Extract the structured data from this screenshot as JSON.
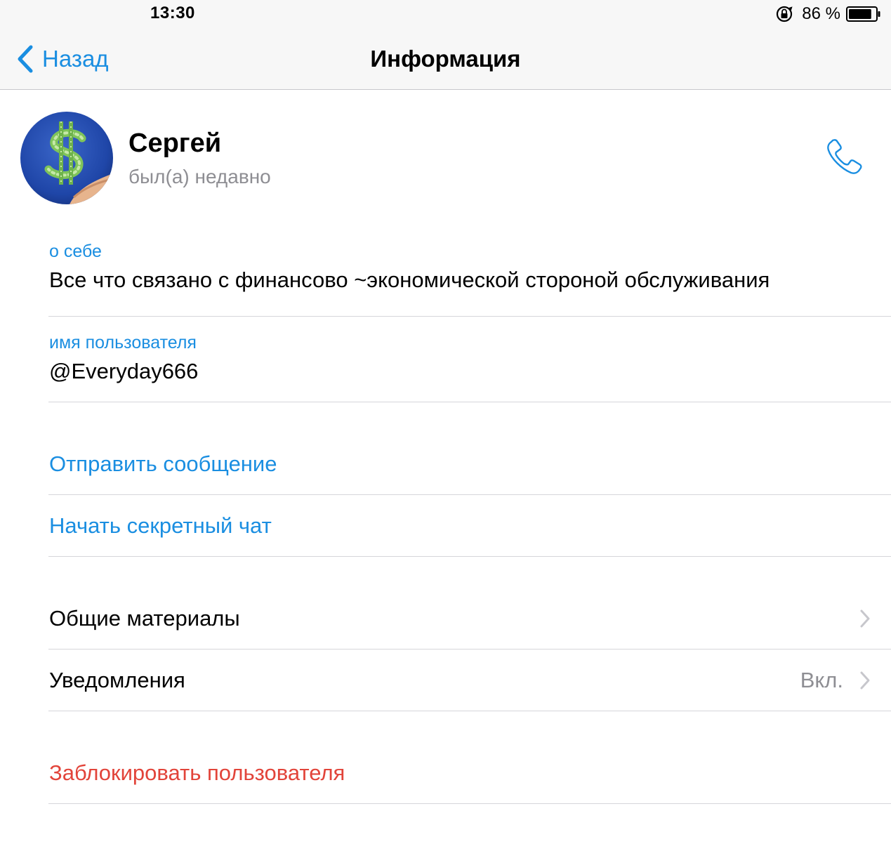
{
  "status_bar": {
    "time": "13:30",
    "battery_percent": "86 %",
    "battery_level": 0.86,
    "icons": [
      "orientation-lock-icon",
      "battery-icon"
    ]
  },
  "nav": {
    "back_label": "Назад",
    "title": "Информация"
  },
  "profile": {
    "name": "Сергей",
    "status": "был(а) недавно",
    "call_icon": "phone-icon"
  },
  "about": {
    "label": "о себе",
    "value": "Все что связано с финансово ~экономической стороной обслуживания"
  },
  "username": {
    "label": "имя пользователя",
    "value": "@Everyday666"
  },
  "actions": {
    "send_message": "Отправить сообщение",
    "secret_chat": "Начать секретный чат"
  },
  "settings": {
    "shared_media": "Общие материалы",
    "notifications": "Уведомления",
    "notifications_value": "Вкл."
  },
  "danger": {
    "block_user": "Заблокировать пользователя"
  },
  "colors": {
    "accent": "#1a8ee1",
    "destructive": "#e2443a",
    "secondary_text": "#8e8e93",
    "separator": "#d6d6da",
    "nav_background": "#f7f7f7"
  }
}
